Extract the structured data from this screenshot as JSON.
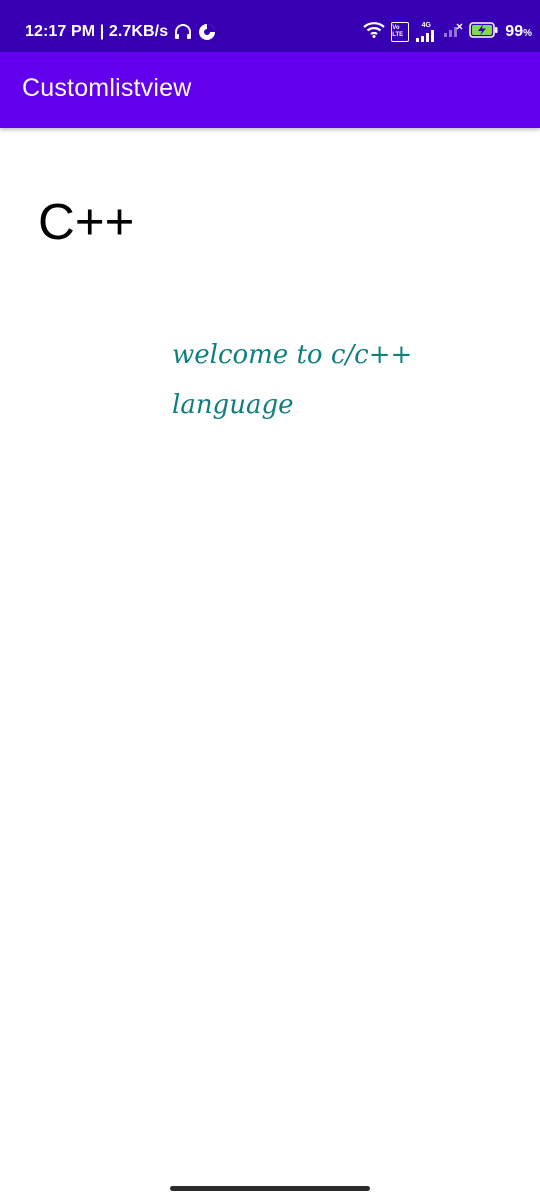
{
  "status_bar": {
    "time_speed": "12:17 PM | 2.7KB/s",
    "volte": "Vo LTE",
    "network": "4G",
    "battery": "99"
  },
  "app_bar": {
    "title": "Customlistview"
  },
  "list": {
    "items": [
      {
        "title": "C++",
        "description": "welcome to c/c++ language"
      }
    ]
  },
  "colors": {
    "status_bar": "#3700b3",
    "app_bar": "#6200ee",
    "description_text": "#0f7f7f"
  },
  "icons": [
    "headset-icon",
    "data-saver-icon",
    "wifi-icon",
    "volte-icon",
    "signal-icon",
    "signal-empty-icon",
    "battery-charging-icon"
  ]
}
